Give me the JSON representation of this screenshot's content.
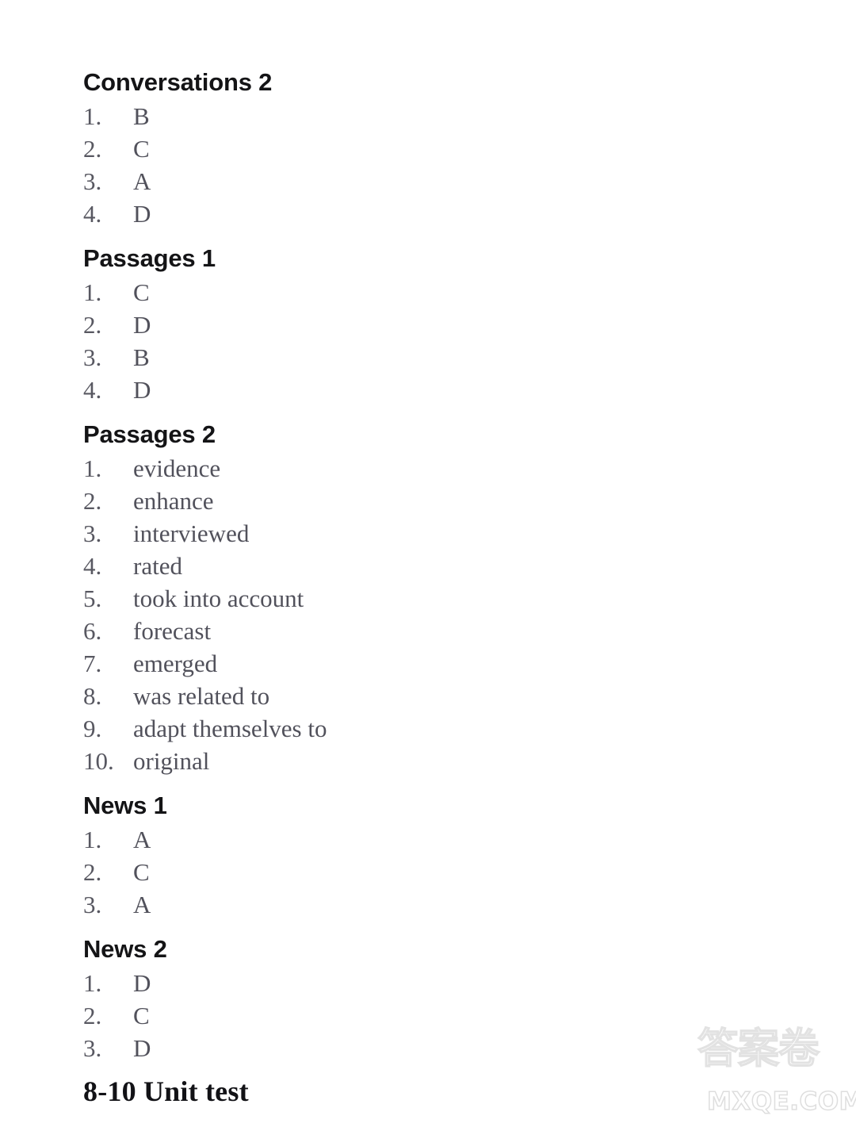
{
  "document": {
    "page_background": "#ffffff",
    "text_color": "#3b3b46",
    "heading_color": "#141416"
  },
  "sections": [
    {
      "heading": "Conversations 2",
      "items": [
        {
          "num": "1.",
          "value": "B"
        },
        {
          "num": "2.",
          "value": "C"
        },
        {
          "num": "3.",
          "value": "A"
        },
        {
          "num": "4.",
          "value": "D"
        }
      ]
    },
    {
      "heading": "Passages 1",
      "items": [
        {
          "num": "1.",
          "value": "C"
        },
        {
          "num": "2.",
          "value": "D"
        },
        {
          "num": "3.",
          "value": "B"
        },
        {
          "num": "4.",
          "value": "D"
        }
      ]
    },
    {
      "heading": "Passages 2",
      "items": [
        {
          "num": "1.",
          "value": "evidence"
        },
        {
          "num": "2.",
          "value": "enhance"
        },
        {
          "num": "3.",
          "value": "interviewed"
        },
        {
          "num": "4.",
          "value": "rated"
        },
        {
          "num": "5.",
          "value": "took into account"
        },
        {
          "num": "6.",
          "value": "forecast"
        },
        {
          "num": "7.",
          "value": "emerged"
        },
        {
          "num": "8.",
          "value": "was related to"
        },
        {
          "num": "9.",
          "value": "adapt themselves to"
        },
        {
          "num": "10.",
          "value": "original"
        }
      ]
    },
    {
      "heading": "News 1",
      "items": [
        {
          "num": "1.",
          "value": "A"
        },
        {
          "num": "2.",
          "value": "C"
        },
        {
          "num": "3.",
          "value": "A"
        }
      ]
    },
    {
      "heading": "News 2",
      "items": [
        {
          "num": "1.",
          "value": "D"
        },
        {
          "num": "2.",
          "value": "C"
        },
        {
          "num": "3.",
          "value": "D"
        }
      ]
    }
  ],
  "unit_title": "8-10 Unit test",
  "watermark": {
    "cjk": "答案卷",
    "domain": "MXQE.COM",
    "color": "#e2e2e2"
  }
}
